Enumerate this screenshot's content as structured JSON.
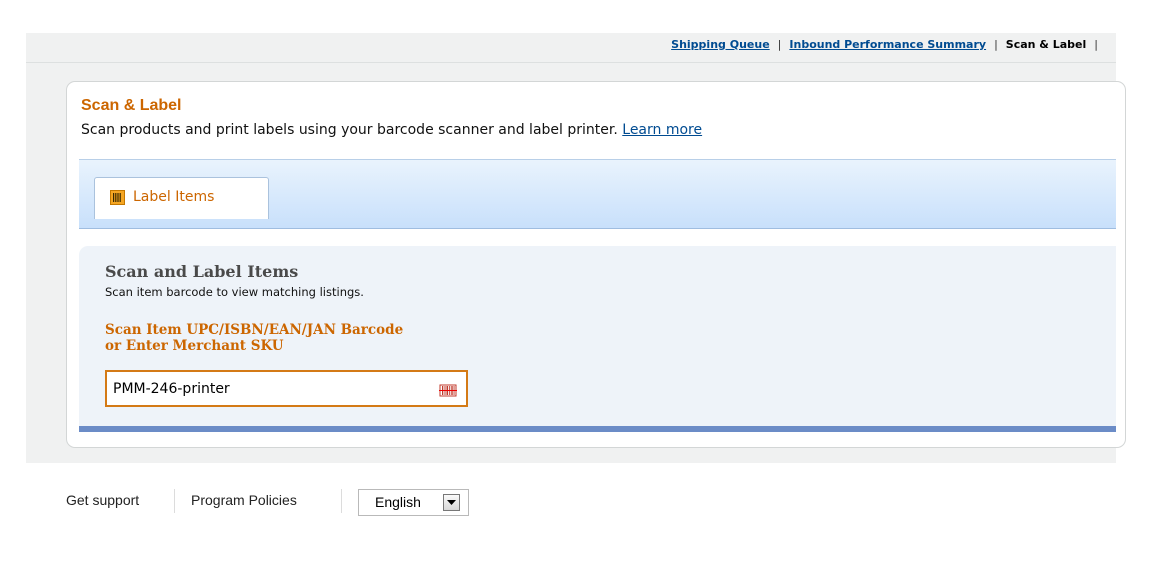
{
  "nav": {
    "links": [
      {
        "label": "Shipping Queue"
      },
      {
        "label": "Inbound Performance Summary"
      },
      {
        "label": "Scan & Label"
      }
    ],
    "separator": "|"
  },
  "page": {
    "title": "Scan & Label",
    "subtitle": "Scan products and print labels using your barcode scanner and label printer.",
    "learn_more": "Learn more"
  },
  "tabs": [
    {
      "label": "Label Items",
      "icon": "barcode-icon",
      "active": true
    }
  ],
  "panel": {
    "title": "Scan and Label Items",
    "subtitle": "Scan item barcode to view matching listings.",
    "field_label_line1": "Scan Item UPC/ISBN/EAN/JAN Barcode",
    "field_label_line2": "or Enter Merchant SKU",
    "input_value": "PMM-246-printer",
    "input_icon": "barcode-icon"
  },
  "footer": {
    "support": "Get support",
    "policies": "Program Policies",
    "language": "English"
  },
  "colors": {
    "accent": "#cc6600",
    "link": "#004b91",
    "panel_bar": "#6b8cc7"
  }
}
